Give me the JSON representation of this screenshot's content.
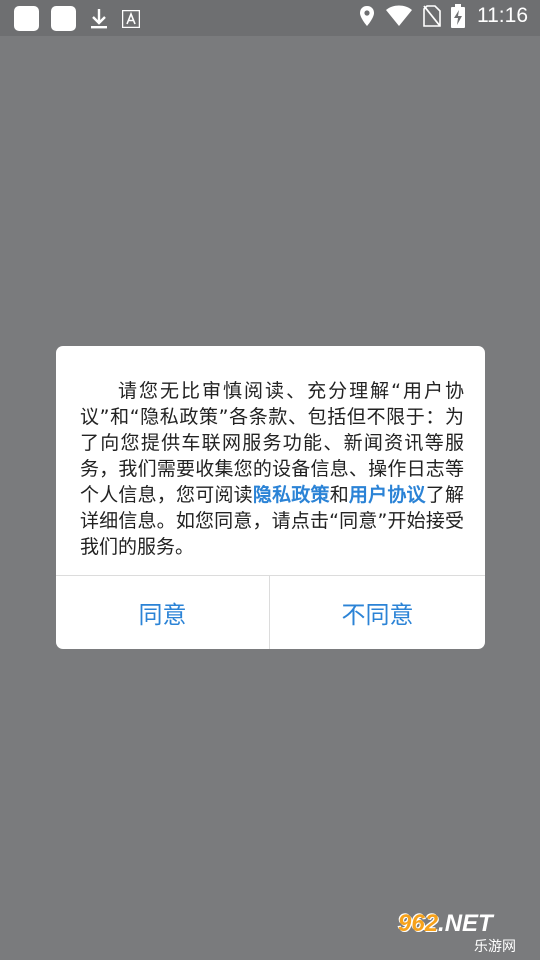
{
  "statusbar": {
    "time": "11:16",
    "icons": [
      "app-square-icon",
      "app-square-icon",
      "download-icon",
      "font-icon",
      "location-icon",
      "wifi-icon",
      "no-sim-icon",
      "battery-charging-icon"
    ]
  },
  "dialog": {
    "message_part1": "请您无比审慎阅读、充分理解“用户协议”和“隐私政策”各条款、包括但不限于：为了向您提供车联网服务功能、新闻资讯等服务，我们需要收集您的设备信息、操作日志等个人信息，您可阅读",
    "link_privacy": "隐私政策",
    "message_and": "和",
    "link_user_agreement": "用户协议",
    "message_part2": "了解详细信息。如您同意，请点击“同意”开始接受我们的服务。",
    "agree_label": "同意",
    "disagree_label": "不同意"
  },
  "watermark": {
    "number": "962",
    "suffix": ".NET",
    "subtitle": "乐游网"
  },
  "colors": {
    "overlay": "#7a7b7d",
    "accent": "#2b83d6",
    "dialog_bg": "#ffffff"
  }
}
